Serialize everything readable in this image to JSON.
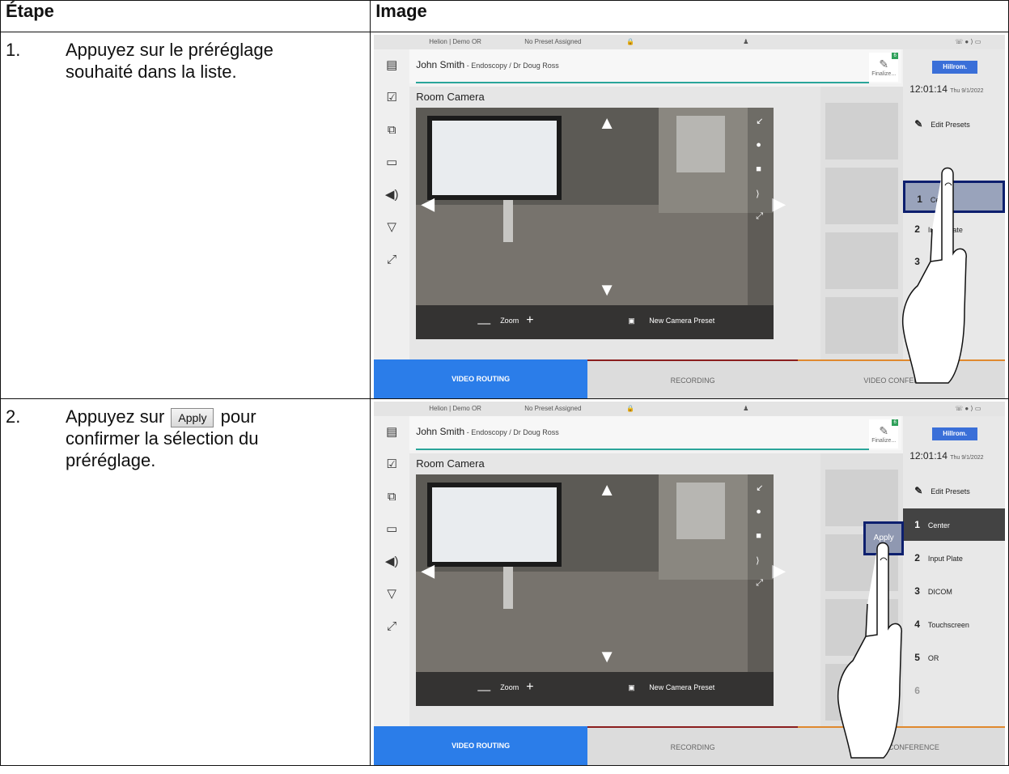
{
  "table": {
    "header_step": "Étape",
    "header_image": "Image"
  },
  "rows": [
    {
      "num": "1.",
      "text": "Appuyez sur le préréglage souhaité dans la liste."
    },
    {
      "num": "2.",
      "text_before": "Appuyez sur",
      "button_label": "Apply",
      "text_after": "pour confirmer la sélection du préréglage."
    }
  ],
  "ui": {
    "room": "Helion | Demo OR",
    "preset_status": "No Preset Assigned",
    "patient_name": "John Smith",
    "patient_detail": " - Endoscopy / Dr Doug Ross",
    "finalize": "Finalize...",
    "finalize_badge": "6",
    "logo": "Hillrom.",
    "time": "12:01:14",
    "date": "Thu 9/1/2022",
    "camera_title": "Room Camera",
    "zoom_label": "Zoom",
    "new_preset": "New Camera Preset",
    "edit_presets": "Edit Presets",
    "apply": "Apply",
    "tabs": [
      "VIDEO ROUTING",
      "RECORDING",
      "VIDEO CONFERENCE"
    ],
    "tab_colors": [
      "#2b7de9",
      "#8b1e1e",
      "#e0892e"
    ]
  },
  "presets_step1": [
    {
      "n": "1",
      "label": "Center"
    },
    {
      "n": "2",
      "label": "Input Plate"
    },
    {
      "n": "3",
      "label": ""
    },
    {
      "n": "6",
      "label": ""
    }
  ],
  "presets_step2": [
    {
      "n": "1",
      "label": "Center"
    },
    {
      "n": "2",
      "label": "Input Plate"
    },
    {
      "n": "3",
      "label": "DICOM"
    },
    {
      "n": "4",
      "label": "Touchscreen"
    },
    {
      "n": "5",
      "label": "OR"
    },
    {
      "n": "6",
      "label": ""
    }
  ]
}
